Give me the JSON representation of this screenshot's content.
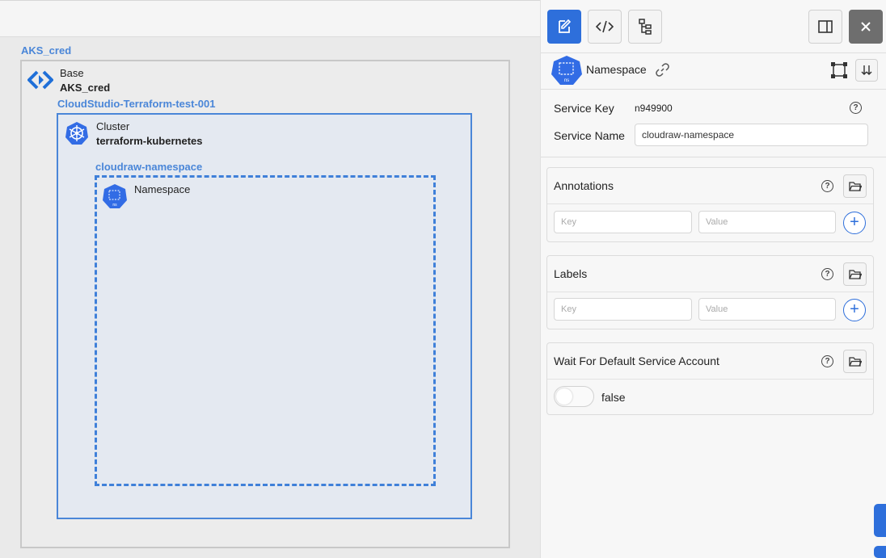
{
  "canvas": {
    "base_group_label": "AKS_cred",
    "base_node": {
      "type": "Base",
      "name": "AKS_cred",
      "icon": "code-brackets-icon"
    },
    "cluster_group_label": "CloudStudio-Terraform-test-001",
    "cluster_node": {
      "type": "Cluster",
      "name": "terraform-kubernetes",
      "icon": "kubernetes-wheel-icon"
    },
    "namespace_group_label": "cloudraw-namespace",
    "namespace_node": {
      "type": "Namespace",
      "icon": "namespace-icon"
    }
  },
  "panel": {
    "toolbar": {
      "edit_icon": "edit-icon",
      "code_icon": "code-icon",
      "tree_icon": "tree-icon",
      "sidebar_icon": "sidebar-toggle-icon",
      "close_icon": "close-icon"
    },
    "header": {
      "title": "Namespace",
      "icon_badge": "ns",
      "link_icon": "link-icon",
      "select_icon": "bounding-box-icon",
      "sort_icon": "sort-down-icon"
    },
    "service_key_label": "Service Key",
    "service_key_value": "n949900",
    "service_name_label": "Service Name",
    "service_name_value": "cloudraw-namespace",
    "annotations": {
      "title": "Annotations",
      "key_placeholder": "Key",
      "value_placeholder": "Value",
      "add": "+"
    },
    "labels": {
      "title": "Labels",
      "key_placeholder": "Key",
      "value_placeholder": "Value",
      "add": "+"
    },
    "wait": {
      "title": "Wait For Default Service Account",
      "value": "false"
    },
    "help_glyph": "?"
  },
  "colors": {
    "accent": "#2e6fdb",
    "group_label": "#4a86d8",
    "close_button": "#6e6e6e"
  }
}
